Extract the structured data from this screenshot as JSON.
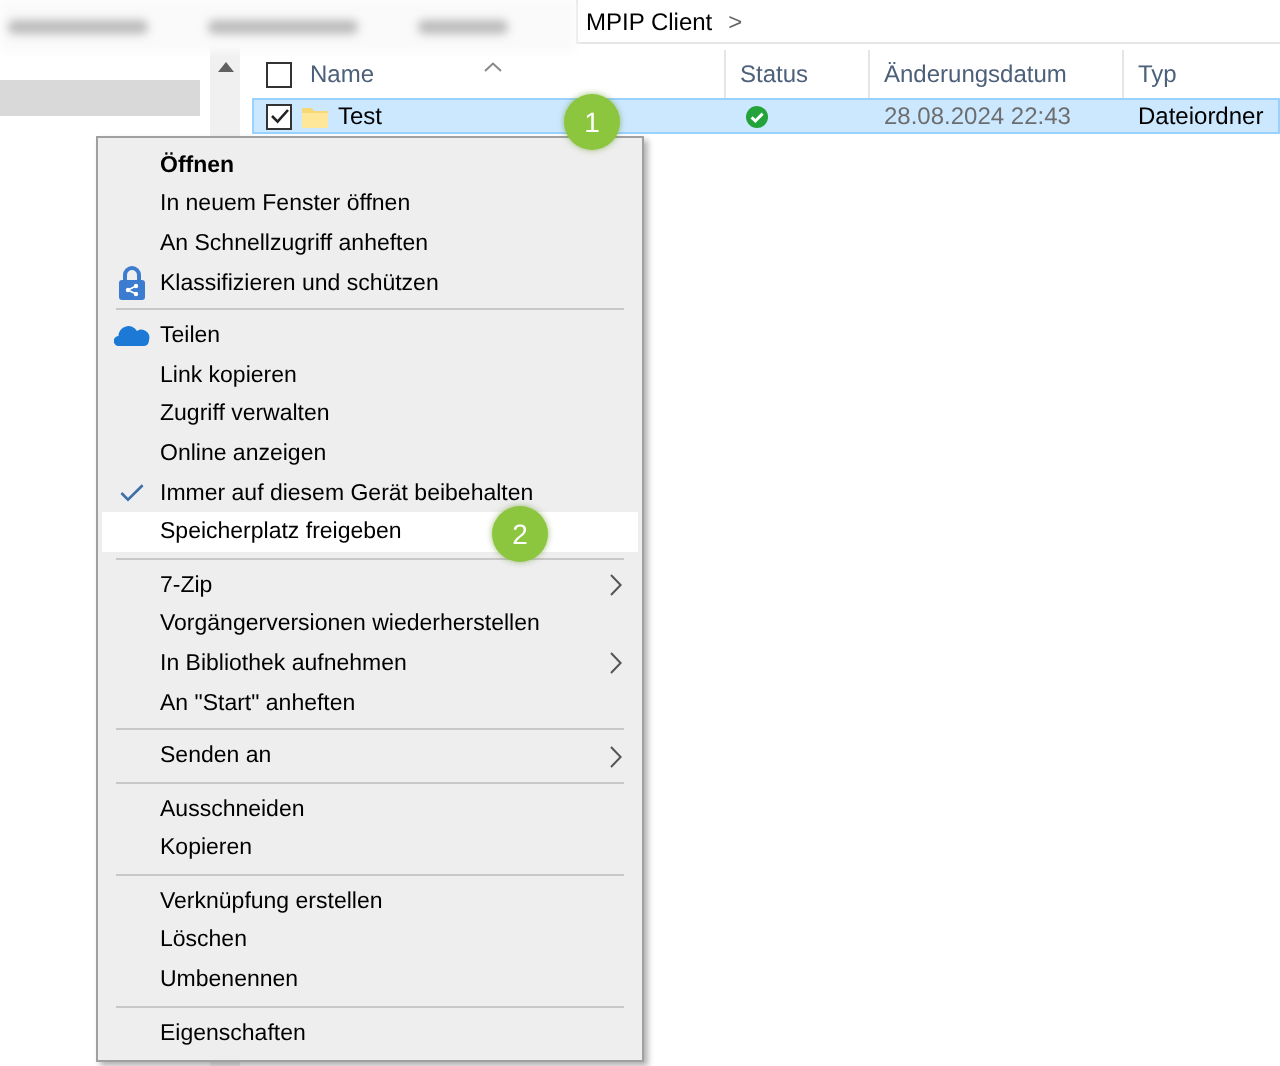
{
  "address_bar": {
    "path": "MPIP Client",
    "separator": ">"
  },
  "file_list": {
    "all_checked": false,
    "columns": [
      {
        "label": "Name",
        "sorted": true
      },
      {
        "label": "Status",
        "sorted": false
      },
      {
        "label": "Änderungsdatum",
        "sorted": false
      },
      {
        "label": "Typ",
        "sorted": false
      }
    ],
    "rows": [
      {
        "name": "Test",
        "checked": true,
        "selected": true,
        "synced": true,
        "date": "28.08.2024 22:43",
        "type": "Dateiordner"
      }
    ]
  },
  "context_menu": [
    {
      "kind": "plain",
      "label": "Öffnen",
      "default": true,
      "checked": false,
      "highlighted": false,
      "submenu": false
    },
    {
      "kind": "plain",
      "label": "In neuem Fenster öffnen",
      "default": false,
      "checked": false,
      "highlighted": false,
      "submenu": false
    },
    {
      "kind": "plain",
      "label": "An Schnellzugriff anheften",
      "default": false,
      "checked": false,
      "highlighted": false,
      "submenu": false
    },
    {
      "kind": "lock",
      "label": "Klassifizieren und schützen",
      "default": false,
      "checked": false,
      "highlighted": false,
      "submenu": false
    },
    {
      "kind": "separator"
    },
    {
      "kind": "cloud",
      "label": "Teilen",
      "default": false,
      "checked": false,
      "highlighted": false,
      "submenu": false
    },
    {
      "kind": "plain",
      "label": "Link kopieren",
      "default": false,
      "checked": false,
      "highlighted": false,
      "submenu": false
    },
    {
      "kind": "plain",
      "label": "Zugriff verwalten",
      "default": false,
      "checked": false,
      "highlighted": false,
      "submenu": false
    },
    {
      "kind": "plain",
      "label": "Online anzeigen",
      "default": false,
      "checked": false,
      "highlighted": false,
      "submenu": false
    },
    {
      "kind": "plain",
      "label": "Immer auf diesem Gerät beibehalten",
      "default": false,
      "checked": true,
      "highlighted": false,
      "submenu": false
    },
    {
      "kind": "plain",
      "label": "Speicherplatz freigeben",
      "default": false,
      "checked": false,
      "highlighted": true,
      "submenu": false
    },
    {
      "kind": "separator"
    },
    {
      "kind": "plain",
      "label": "7-Zip",
      "default": false,
      "checked": false,
      "highlighted": false,
      "submenu": true
    },
    {
      "kind": "plain",
      "label": "Vorgängerversionen wiederherstellen",
      "default": false,
      "checked": false,
      "highlighted": false,
      "submenu": false
    },
    {
      "kind": "plain",
      "label": "In Bibliothek aufnehmen",
      "default": false,
      "checked": false,
      "highlighted": false,
      "submenu": true
    },
    {
      "kind": "plain",
      "label": "An \"Start\" anheften",
      "default": false,
      "checked": false,
      "highlighted": false,
      "submenu": false
    },
    {
      "kind": "separator"
    },
    {
      "kind": "plain",
      "label": "Senden an",
      "default": false,
      "checked": false,
      "highlighted": false,
      "submenu": true
    },
    {
      "kind": "separator"
    },
    {
      "kind": "plain",
      "label": "Ausschneiden",
      "default": false,
      "checked": false,
      "highlighted": false,
      "submenu": false
    },
    {
      "kind": "plain",
      "label": "Kopieren",
      "default": false,
      "checked": false,
      "highlighted": false,
      "submenu": false
    },
    {
      "kind": "separator"
    },
    {
      "kind": "plain",
      "label": "Verknüpfung erstellen",
      "default": false,
      "checked": false,
      "highlighted": false,
      "submenu": false
    },
    {
      "kind": "plain",
      "label": "Löschen",
      "default": false,
      "checked": false,
      "highlighted": false,
      "submenu": false
    },
    {
      "kind": "plain",
      "label": "Umbenennen",
      "default": false,
      "checked": false,
      "highlighted": false,
      "submenu": false
    },
    {
      "kind": "separator"
    },
    {
      "kind": "plain",
      "label": "Eigenschaften",
      "default": false,
      "checked": false,
      "highlighted": false,
      "submenu": false
    }
  ],
  "step_badges": [
    {
      "text": "1"
    },
    {
      "text": "2"
    }
  ]
}
